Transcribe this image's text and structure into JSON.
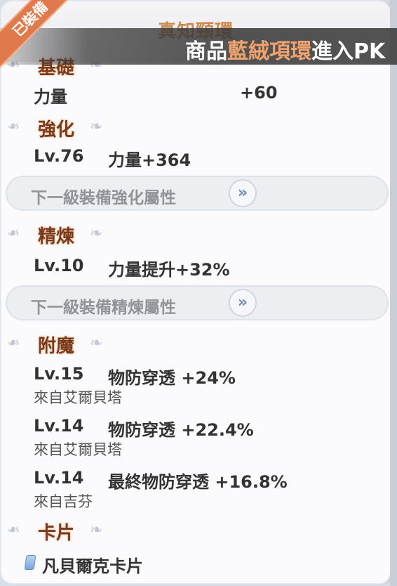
{
  "corner_badge": "已裝備",
  "item": {
    "name": "真知頸環"
  },
  "banner": {
    "prefix": "商品",
    "highlight": "藍絨項環",
    "suffix": "進入PK"
  },
  "sections": {
    "base": {
      "label": "基礎",
      "stat_name": "力量",
      "stat_value": "+60"
    },
    "enhance": {
      "label": "強化",
      "level": "Lv.76",
      "effect": "力量+364",
      "next_button": "下一級裝備強化屬性"
    },
    "refine": {
      "label": "精煉",
      "level": "Lv.10",
      "effect": "力量提升+32%",
      "next_button": "下一級裝備精煉屬性"
    },
    "enchant": {
      "label": "附魔",
      "entries": [
        {
          "level": "Lv.15",
          "effect": "物防穿透 +24%",
          "source": "來自艾爾貝塔"
        },
        {
          "level": "Lv.14",
          "effect": "物防穿透 +22.4%",
          "source": "來自艾爾貝塔"
        },
        {
          "level": "Lv.14",
          "effect": "最終物防穿透 +16.8%",
          "source": "來自吉芬"
        }
      ]
    },
    "card": {
      "label": "卡片",
      "card_name": "凡貝爾克卡片"
    }
  },
  "icons": {
    "wing": "wing-ornament-icon",
    "arrow": "double-chevron-right-icon",
    "card": "card-icon"
  },
  "colors": {
    "accent": "#e07a4a",
    "section_label": "#7a3a1c",
    "highlight": "#f0a36c"
  }
}
